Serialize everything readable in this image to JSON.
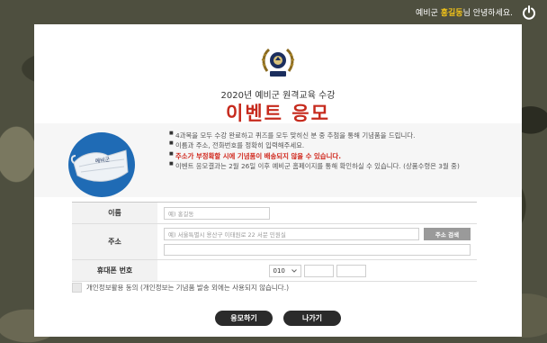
{
  "topbar": {
    "greeting_prefix": "예비군 ",
    "user_name": "홍길동",
    "greeting_suffix": "님 안녕하세요.",
    "logout_icon": "power-icon"
  },
  "header": {
    "logo_icon": "reserve-forces-emblem-icon",
    "subtitle": "2020년 예비군 원격교육 수강",
    "title": "이벤트 응모"
  },
  "info": {
    "notes": [
      {
        "text": "4과목을 모두 수강 완료하고 퀴즈를 모두 맞히신 분 중 추첨을 통해 기념품을 드립니다.",
        "highlight": false
      },
      {
        "text": "이름과 주소, 전화번호를 정확히 입력해주세요.",
        "highlight": false
      },
      {
        "text": "주소가 부정확할 시에 기념품이 배송되지 않을 수 있습니다.",
        "highlight": true
      },
      {
        "text": "이벤트 응모결과는 2월 26일 이후 예비군 홈페이지를 통해 확인하실 수 있습니다. (상품수령은 3월 중)",
        "highlight": false
      }
    ],
    "image_icon": "face-mask-icon",
    "mask_text": "예비군"
  },
  "form": {
    "name_label": "이름",
    "name_placeholder": "예) 홍길동",
    "address_label": "주소",
    "address_placeholder": "예) 서울특별시 용산구 이태원로 22 서문 민원실",
    "address_button": "주소 검색",
    "phone_label": "휴대폰 번호",
    "phone_prefix": "010"
  },
  "consent": {
    "label": "개인정보활용 동의 (개인정보는 기념품 발송 외에는 사용되지 않습니다.)"
  },
  "actions": {
    "submit": "응모하기",
    "exit": "나가기"
  },
  "colors": {
    "title_red": "#c62a1d",
    "user_yellow": "#f5c518",
    "button_dark": "#2b2b2b"
  }
}
